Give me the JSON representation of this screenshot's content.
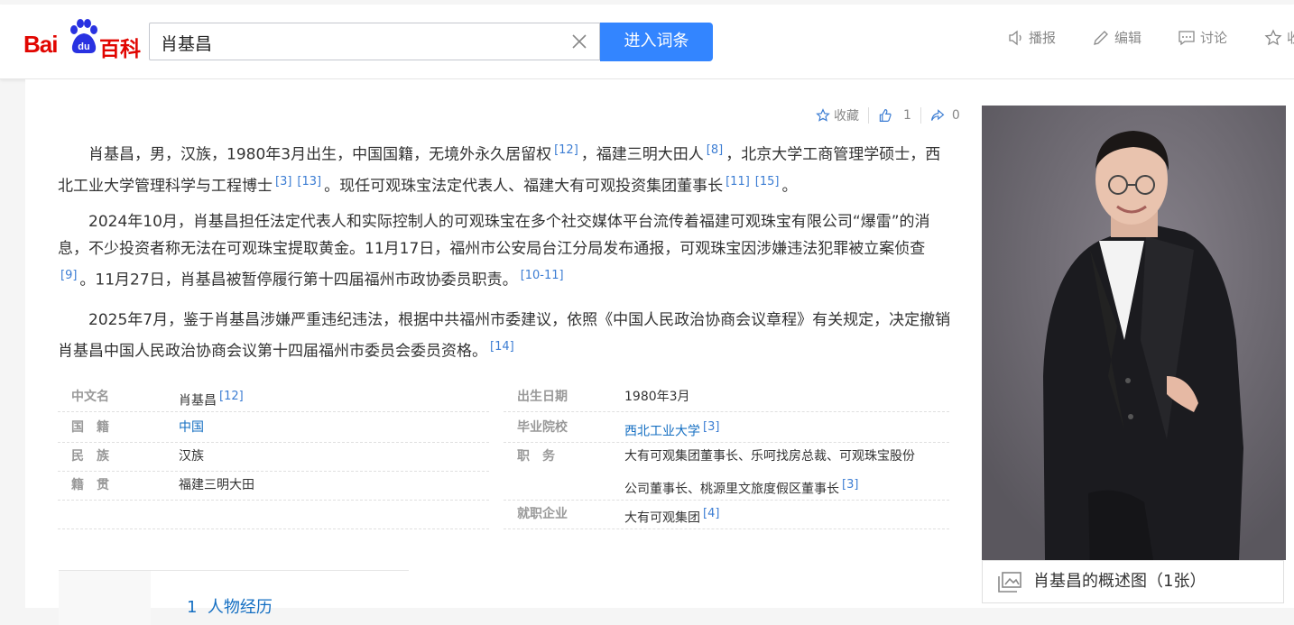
{
  "logo": {
    "bai": "Bai",
    "du": "du",
    "baike": "百科"
  },
  "search": {
    "value": "肖基昌",
    "button": "进入词条"
  },
  "toolbar": {
    "broadcast": "播报",
    "edit": "编辑",
    "discuss": "讨论",
    "collect": "收"
  },
  "actions": {
    "collect": "收藏",
    "likes": "1",
    "shares": "0"
  },
  "paragraphs": {
    "p1": {
      "t1": "肖基昌，男，汉族，1980年3月出生，中国国籍，无境外永久居留权",
      "r1": "[12]",
      "t2": "，福建三明大田人",
      "r2": "[8]",
      "t3": "，北京大学工商管理学硕士，西北工业大学管理科学与工程博士",
      "r3": "[3]",
      "r4": "[13]",
      "t4": "。现任可观珠宝法定代表人、福建大有可观投资集团董事长",
      "r5": "[11]",
      "r6": "[15]",
      "t5": "。"
    },
    "p2": {
      "t1": "2024年10月，肖基昌担任法定代表人和实际控制人的可观珠宝在多个社交媒体平台流传着福建可观珠宝有限公司“爆雷”的消息，不少投资者称无法在可观珠宝提取黄金。11月17日，福州市公安局台江分局发布通报，可观珠宝因涉嫌违法犯罪被立案侦查",
      "r1": "[9]",
      "t2": "。11月27日，肖基昌被暂停履行第十四届福州市政协委员职责。",
      "r2": "[10-11]"
    },
    "p3": {
      "t1": "2025年7月，鉴于肖基昌涉嫌严重违纪违法，根据中共福州市委建议，依照《中国人民政治协商会议章程》有关规定，决定撤销肖基昌中国人民政治协商会议第十四届福州市委员会委员资格。",
      "r1": "[14]"
    }
  },
  "info": {
    "name_k": "中文名",
    "name_v": "肖基昌",
    "name_r": "[12]",
    "nation_k": "国　籍",
    "nation_v": "中国",
    "ethnic_k": "民　族",
    "ethnic_v": "汉族",
    "native_k": "籍　贯",
    "native_v": "福建三明大田",
    "birth_k": "出生日期",
    "birth_v": "1980年3月",
    "school_k": "毕业院校",
    "school_v": "西北工业大学",
    "school_r": "[3]",
    "job_k": "职　务",
    "job_v1": "大有可观集团董事长、乐呵找房总裁、可观珠宝股份",
    "job_v2": "公司董事长、桃源里文旅度假区董事长",
    "job_r": "[3]",
    "company_k": "就职企业",
    "company_v": "大有可观集团",
    "company_r": "[4]"
  },
  "caption": "肖基昌的概述图（1张）",
  "toc": {
    "num": "1",
    "title": "人物经历"
  },
  "colors": {
    "brand_red": "#e10601",
    "brand_blue": "#2932e1",
    "button_blue": "#3385ff",
    "link": "#136ec2"
  }
}
